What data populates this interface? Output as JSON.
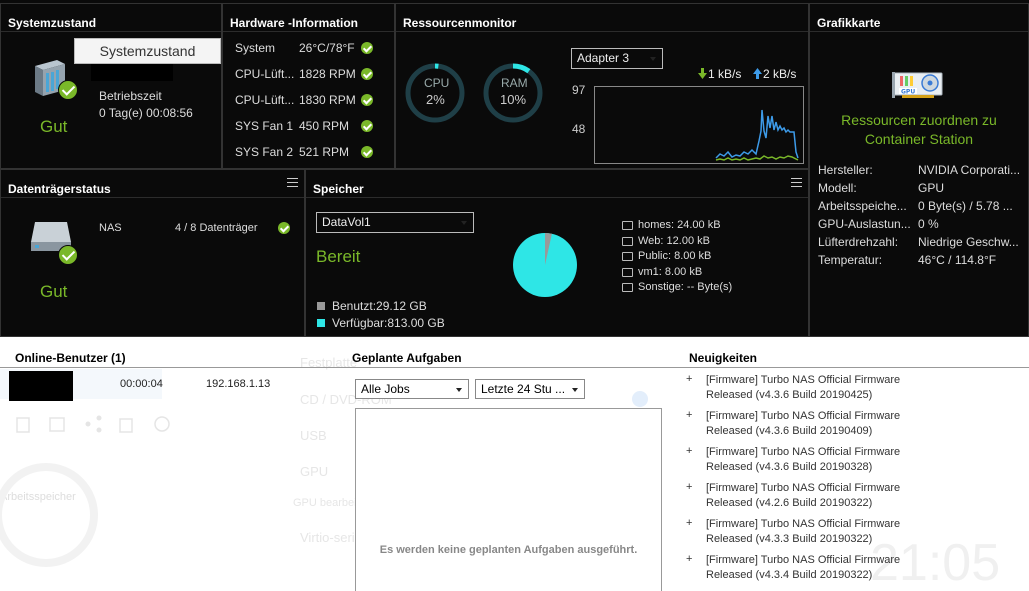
{
  "system": {
    "title": "Systemzustand",
    "tooltip": "Systemzustand",
    "uptime_label": "Betriebszeit",
    "uptime_value": "0 Tag(e) 00:08:56",
    "status": "Gut"
  },
  "hardware": {
    "title": "Hardware -Information",
    "rows": [
      {
        "label": "System",
        "value": "26°C/78°F"
      },
      {
        "label": "CPU-Lüft...",
        "value": "1828 RPM"
      },
      {
        "label": "CPU-Lüft...",
        "value": "1830 RPM"
      },
      {
        "label": "SYS Fan 1",
        "value": "450 RPM"
      },
      {
        "label": "SYS Fan 2",
        "value": "521 RPM"
      }
    ]
  },
  "resource": {
    "title": "Ressourcenmonitor",
    "cpu_label": "CPU",
    "cpu_value": "2%",
    "cpu_fraction": 0.02,
    "ram_label": "RAM",
    "ram_value": "10%",
    "ram_fraction": 0.1,
    "adapter": "Adapter 3",
    "down": "1 kB/s",
    "up": "2 kB/s",
    "y_top": "97",
    "y_mid": "48"
  },
  "gpu": {
    "title": "Grafikkarte",
    "link_line1": "Ressourcen zuordnen zu",
    "link_line2": "Container Station",
    "rows": [
      {
        "label": "Hersteller:",
        "value": "NVIDIA Corporati..."
      },
      {
        "label": "Modell:",
        "value": "GPU"
      },
      {
        "label": "Arbeitsspeiche...",
        "value": "0 Byte(s) / 5.78 ..."
      },
      {
        "label": "GPU-Auslastun...",
        "value": "0 %"
      },
      {
        "label": "Lüfterdrehzahl:",
        "value": "Niedrige Geschw..."
      },
      {
        "label": "Temperatur:",
        "value": "46°C / 114.8°F"
      }
    ]
  },
  "disk": {
    "title": "Datenträgerstatus",
    "name": "NAS",
    "count": "4 / 8 Datenträger",
    "status": "Gut"
  },
  "storage": {
    "title": "Speicher",
    "volume": "DataVol1",
    "status": "Bereit",
    "used": "Benutzt:29.12 GB",
    "free": "Verfügbar:813.00 GB",
    "used_fraction": 0.0346,
    "folders": [
      "homes: 24.00 kB",
      "Web: 12.00 kB",
      "Public: 8.00 kB",
      "vm1: 8.00 kB",
      "Sonstige: -- Byte(s)"
    ]
  },
  "online": {
    "title": "Online-Benutzer (1)",
    "time": "00:00:04",
    "ip": "192.168.1.13"
  },
  "tasks": {
    "title": "Geplante Aufgaben",
    "filter_jobs": "Alle Jobs",
    "filter_time": "Letzte 24 Stu ...",
    "empty": "Es werden keine geplanten Aufgaben ausgeführt."
  },
  "news": {
    "title": "Neuigkeiten",
    "items": [
      {
        "l1": "[Firmware] Turbo NAS Official Firmware",
        "l2": "Released (v4.3.6 Build 20190425)"
      },
      {
        "l1": "[Firmware] Turbo NAS Official Firmware",
        "l2": "Released (v4.3.6 Build 20190409)"
      },
      {
        "l1": "[Firmware] Turbo NAS Official Firmware",
        "l2": "Released (v4.3.6 Build 20190328)"
      },
      {
        "l1": "[Firmware] Turbo NAS Official Firmware",
        "l2": "Released (v4.2.6 Build 20190322)"
      },
      {
        "l1": "[Firmware] Turbo NAS Official Firmware",
        "l2": "Released (v4.3.3 Build 20190322)"
      },
      {
        "l1": "[Firmware] Turbo NAS Official Firmware",
        "l2": "Released (v4.3.4 Build 20190322)"
      }
    ]
  },
  "background": {
    "items": [
      "Festplatte",
      "CD / DVD-ROM",
      "USB",
      "GPU",
      "GPU bearbeiten",
      "Virtio-serial",
      "Arbeitsspeicher"
    ],
    "clock": "21:05"
  },
  "colors": {
    "accent_green": "#7ab829",
    "cyan": "#2ee6e6"
  }
}
